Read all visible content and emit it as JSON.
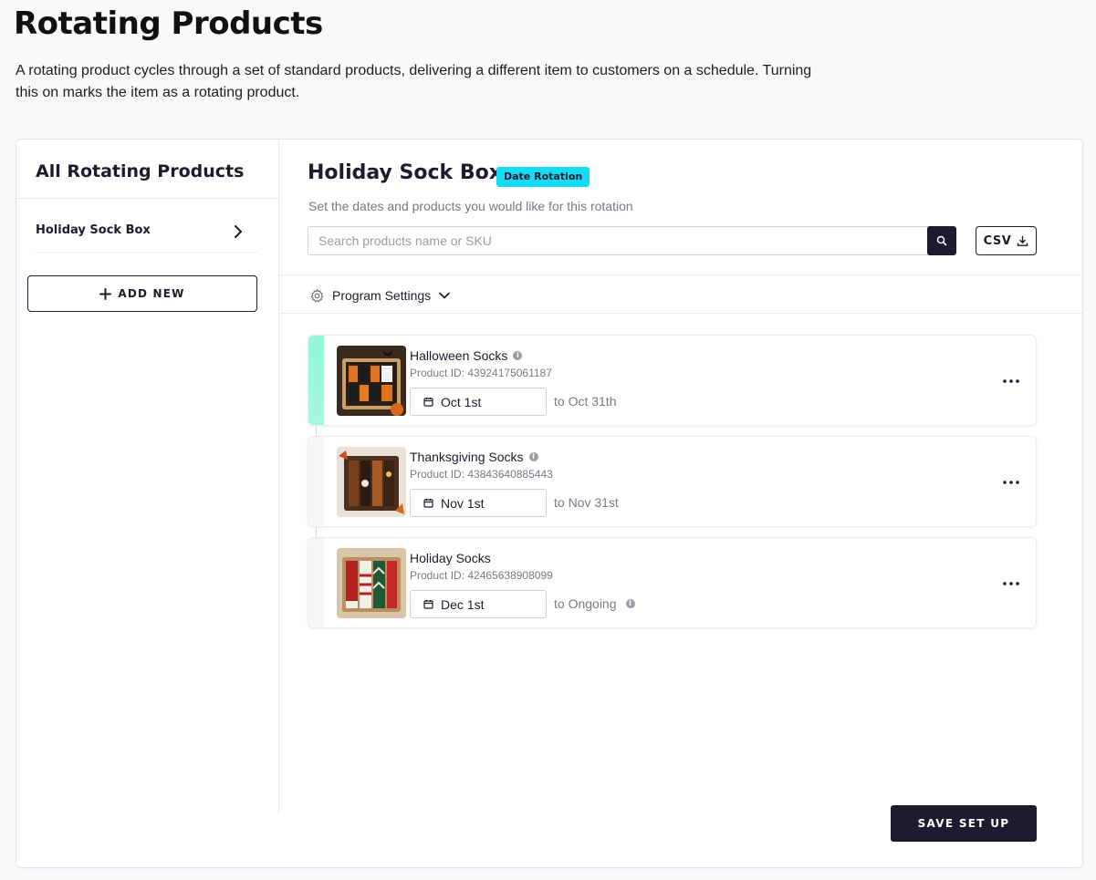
{
  "page": {
    "title": "Rotating Products",
    "description": "A rotating product cycles through a set of standard products, delivering a different item to customers on a schedule. Turning this on marks the item as a rotating product."
  },
  "sidebar": {
    "title": "All Rotating Products",
    "items": [
      {
        "label": "Holiday Sock Box",
        "icon": "chevron-right-icon"
      }
    ],
    "add_button": {
      "label": "ADD NEW",
      "icon": "plus-icon"
    }
  },
  "main": {
    "title": "Holiday Sock Box",
    "badge": "Date Rotation",
    "subtitle": "Set the dates and products you would like for this rotation",
    "search": {
      "placeholder": "Search products name or SKU",
      "value": "",
      "icon": "search-icon"
    },
    "csv_button": {
      "label": "CSV",
      "icon": "download-icon"
    },
    "program_settings": {
      "label": "Program Settings",
      "icon": "gear-icon",
      "toggle_icon": "chevron-down-icon"
    },
    "products": [
      {
        "name": "Halloween Socks",
        "product_id": "Product ID: 43924175061187",
        "start": "Oct 1st",
        "end": "to Oct 31th",
        "active": true,
        "name_info": true,
        "end_info": false
      },
      {
        "name": "Thanksgiving Socks",
        "product_id": "Product ID: 43843640885443",
        "start": "Nov 1st",
        "end": "to Nov 31st",
        "active": false,
        "name_info": true,
        "end_info": false
      },
      {
        "name": "Holiday Socks",
        "product_id": "Product ID: 42465638908099",
        "start": "Dec 1st",
        "end": "to Ongoing",
        "active": false,
        "name_info": false,
        "end_info": true
      }
    ],
    "save_button": "SAVE SET UP"
  },
  "colors": {
    "primary": "#1d1b2e",
    "badge": "#14dcf5",
    "active_accent": "#92f5dc",
    "muted_text": "#777a85",
    "border": "#cfd0d6"
  }
}
